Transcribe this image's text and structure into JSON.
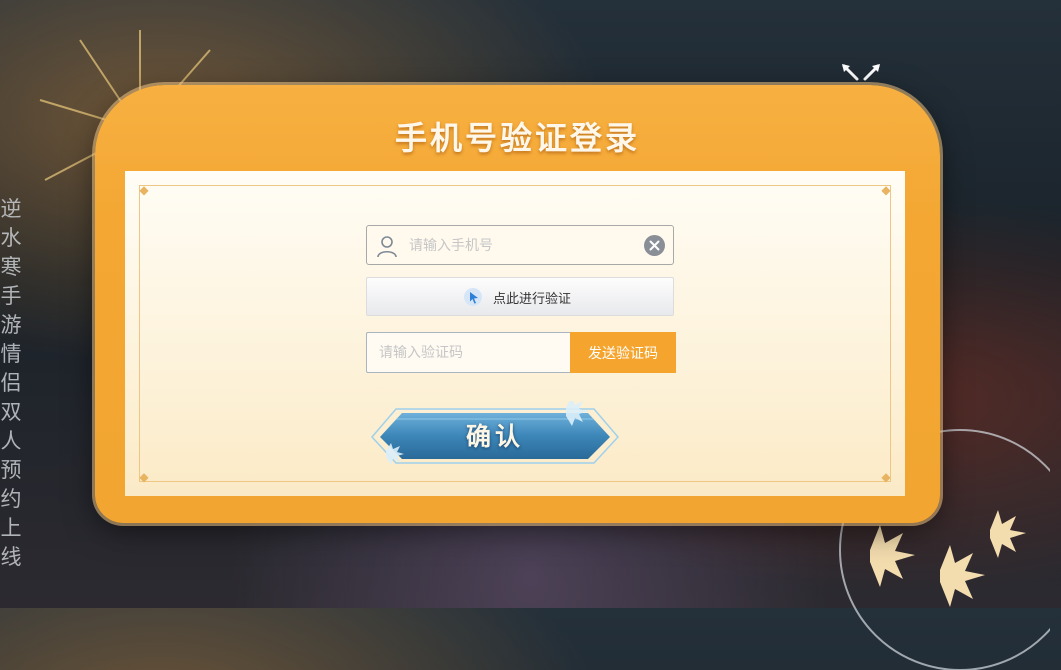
{
  "side_banner": {
    "text": "逆水寒手游情侣双人预约上线"
  },
  "dialog": {
    "title": "手机号验证登录",
    "phone_field": {
      "placeholder": "请输入手机号",
      "value": ""
    },
    "captcha": {
      "label": "点此进行验证"
    },
    "code_field": {
      "placeholder": "请输入验证码",
      "value": ""
    },
    "send_code_label": "发送验证码",
    "confirm_label": "确认"
  },
  "icons": {
    "close": "close-icon",
    "user": "user-icon",
    "clear": "clear-icon",
    "captcha": "captcha-pointer-icon"
  },
  "colors": {
    "dialog_orange": "#f4a733",
    "send_button": "#f5a52e",
    "confirm_blue": "#3c86b8"
  }
}
